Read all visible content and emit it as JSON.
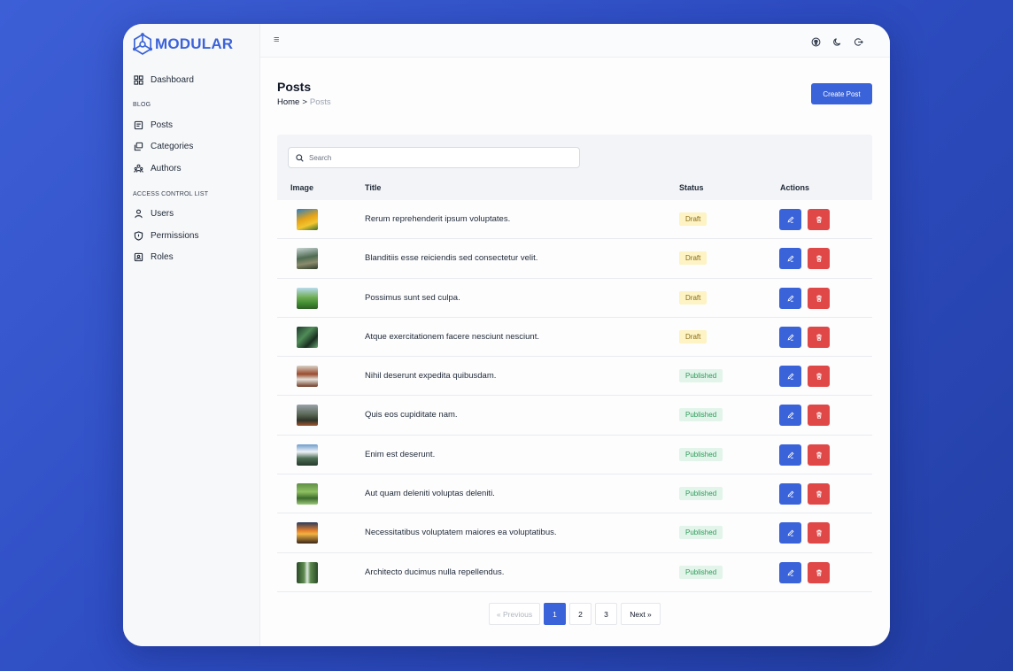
{
  "app": {
    "name": "MODULAR",
    "brand_color": "#3b63d9"
  },
  "sidebar": {
    "dashboard": {
      "label": "Dashboard",
      "icon": "dashboard-icon"
    },
    "sections": [
      {
        "title": "BLOG",
        "items": [
          {
            "label": "Posts",
            "icon": "posts-icon"
          },
          {
            "label": "Categories",
            "icon": "categories-icon"
          },
          {
            "label": "Authors",
            "icon": "authors-icon"
          }
        ]
      },
      {
        "title": "ACCESS CONTROL LIST",
        "items": [
          {
            "label": "Users",
            "icon": "user-icon"
          },
          {
            "label": "Permissions",
            "icon": "shield-icon"
          },
          {
            "label": "Roles",
            "icon": "roles-icon"
          }
        ]
      }
    ]
  },
  "topbar": {
    "menu_icon": "≡",
    "icons": [
      "github-icon",
      "moon-icon",
      "logout-icon"
    ]
  },
  "page": {
    "title": "Posts",
    "breadcrumb": {
      "home": "Home",
      "separator": ">",
      "current": "Posts"
    },
    "create_button": "Create Post"
  },
  "table": {
    "search_placeholder": "Search",
    "columns": [
      "Image",
      "Title",
      "Status",
      "Actions"
    ],
    "rows": [
      {
        "title": "Rerum reprehenderit ipsum voluptates.",
        "status": "Draft"
      },
      {
        "title": "Blanditiis esse reiciendis sed consectetur velit.",
        "status": "Draft"
      },
      {
        "title": "Possimus sunt sed culpa.",
        "status": "Draft"
      },
      {
        "title": "Atque exercitationem facere nesciunt nesciunt.",
        "status": "Draft"
      },
      {
        "title": "Nihil deserunt expedita quibusdam.",
        "status": "Published"
      },
      {
        "title": "Quis eos cupiditate nam.",
        "status": "Published"
      },
      {
        "title": "Enim est deserunt.",
        "status": "Published"
      },
      {
        "title": "Aut quam deleniti voluptas deleniti.",
        "status": "Published"
      },
      {
        "title": "Necessitatibus voluptatem maiores ea voluptatibus.",
        "status": "Published"
      },
      {
        "title": "Architecto ducimus nulla repellendus.",
        "status": "Published"
      }
    ]
  },
  "pagination": {
    "prev": "« Previous",
    "pages": [
      "1",
      "2",
      "3"
    ],
    "current": "1",
    "next": "Next »"
  }
}
